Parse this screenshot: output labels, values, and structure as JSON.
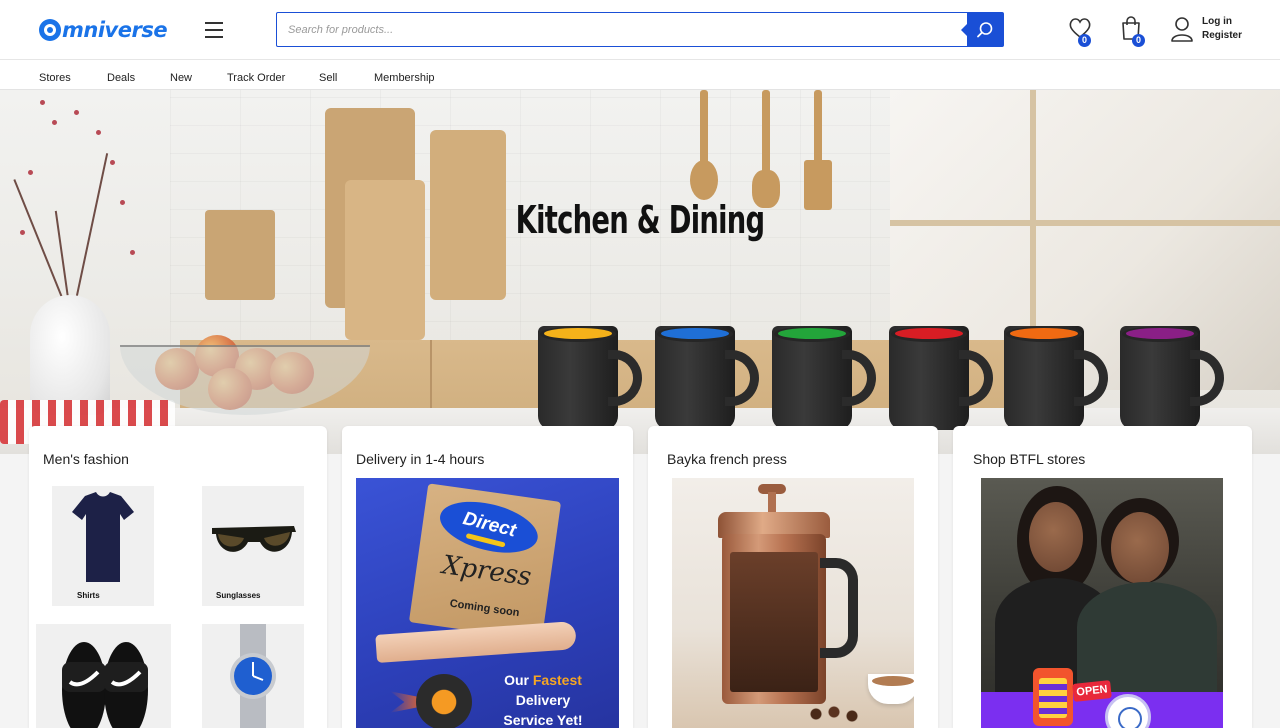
{
  "header": {
    "logo_text": "mniverse",
    "search": {
      "placeholder": "Search for products..."
    },
    "wishlist_count": "0",
    "cart_count": "0",
    "account": {
      "login_label": "Log in",
      "register_label": "Register"
    }
  },
  "nav": {
    "items": [
      "Stores",
      "Deals",
      "New",
      "Track Order",
      "Sell",
      "Membership"
    ]
  },
  "hero": {
    "title": "Kitchen & Dining",
    "mug_colors": [
      "#f5b21a",
      "#1f6fd6",
      "#23a53a",
      "#d81d24",
      "#f06a12",
      "#8a1f86"
    ]
  },
  "cards": [
    {
      "title": "Men's fashion",
      "tiles": [
        {
          "label": "Shirts"
        },
        {
          "label": "Sunglasses"
        },
        {
          "label": ""
        },
        {
          "label": ""
        }
      ]
    },
    {
      "title": "Delivery in 1-4 hours",
      "banner": {
        "brand": "Direct",
        "script": "Xpress",
        "coming": "Coming soon",
        "line1": "Our",
        "line1_accent": "Fastest",
        "line2": "Delivery",
        "line3": "Service Yet!"
      }
    },
    {
      "title": "Bayka french press"
    },
    {
      "title": "Shop BTFL stores",
      "open_tag": "OPEN"
    }
  ]
}
